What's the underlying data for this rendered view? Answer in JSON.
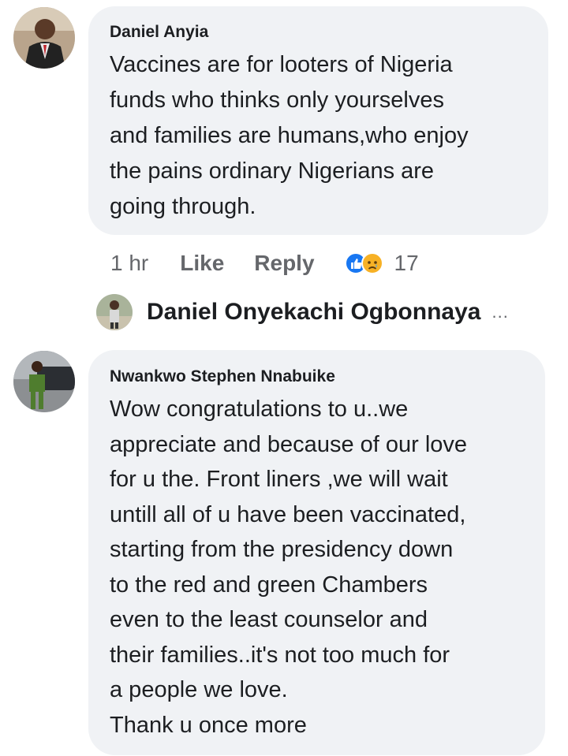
{
  "comments": [
    {
      "author": "Daniel Anyia",
      "avatar_icon": "profile-photo-icon",
      "text": "Vaccines are for looters of Nigeria\nfunds who thinks only yourselves\nand families are humans,who enjoy\nthe pains ordinary Nigerians are\ngoing through."
    },
    {
      "author": "Nwankwo Stephen Nnabuike",
      "avatar_icon": "profile-photo-icon",
      "text": "Wow congratulations to u..we\nappreciate and because of our love\nfor u the. Front liners ,we will wait\nuntill all of u have been vaccinated,\nstarting from the presidency down\nto the red and green Chambers\neven to the least counselor and\ntheir families..it's not too much for\na people we love.\nThank u once more"
    }
  ],
  "actions": {
    "time": "1 hr",
    "like_label": "Like",
    "reply_label": "Reply",
    "reaction_icons": [
      "like-icon",
      "sad-icon"
    ],
    "reaction_count": "17"
  },
  "reply_summary": {
    "name": "Daniel Onyekachi Ogbonnaya",
    "more": "..."
  },
  "colors": {
    "bubble": "#f0f2f5",
    "text": "#1c1e21",
    "muted": "#65676b",
    "like_blue": "#1877f2",
    "sad_yellow": "#f7b125"
  }
}
